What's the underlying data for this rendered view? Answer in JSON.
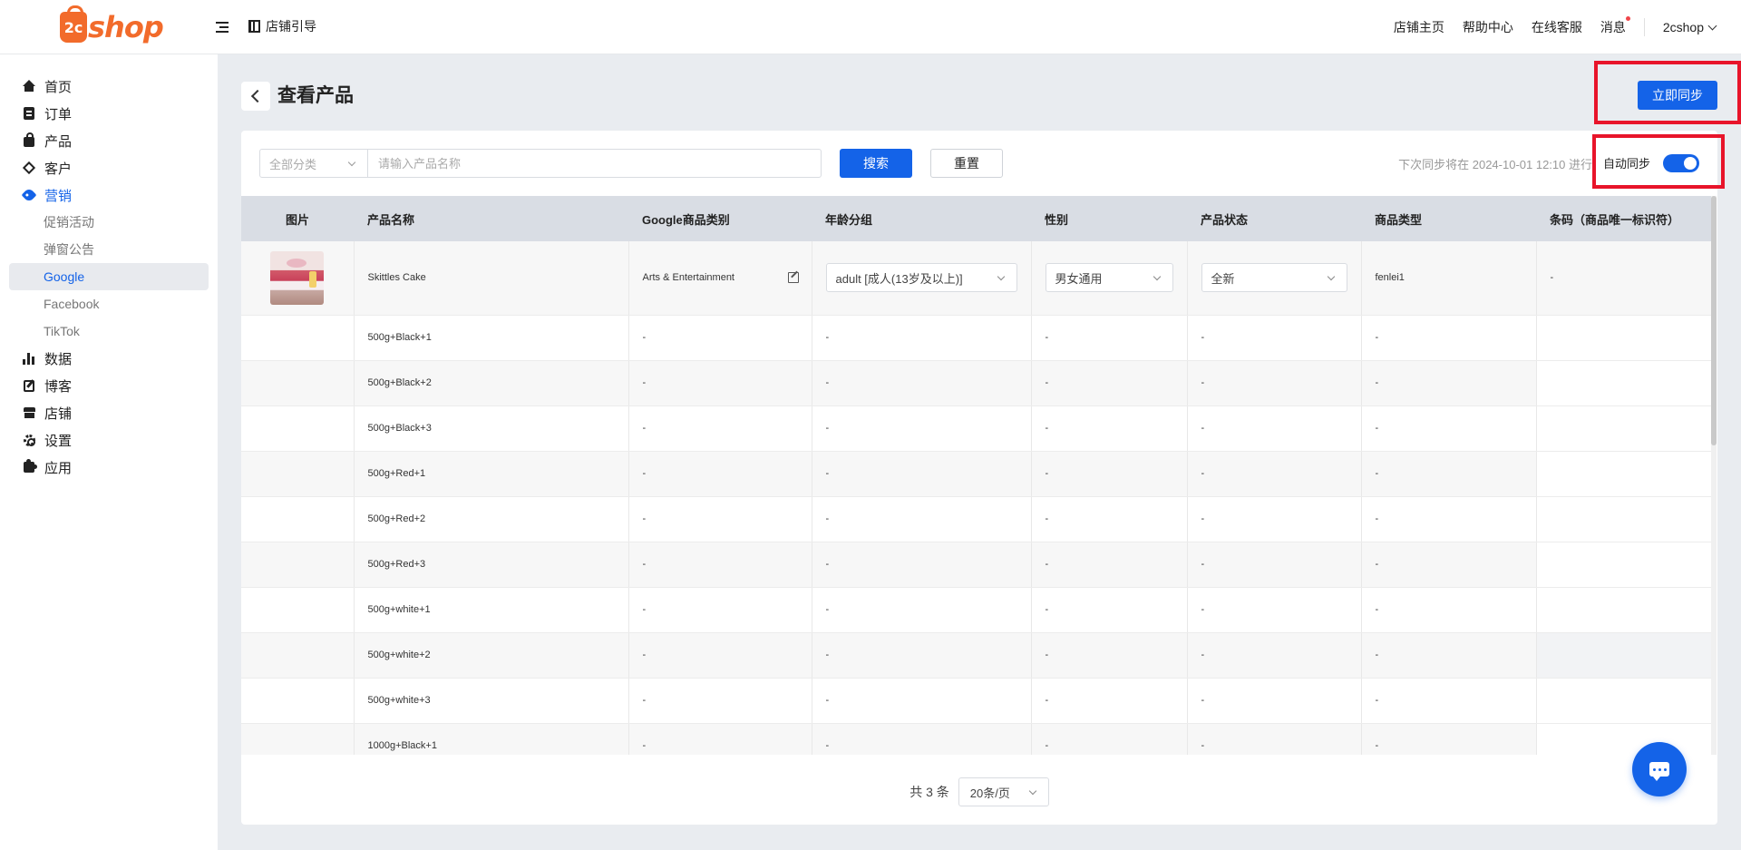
{
  "brand": {
    "logo_mark": "2c",
    "logo_text": "shop",
    "color": "#f26b2b"
  },
  "header": {
    "guide_label": "店铺引导",
    "links": [
      "店铺主页",
      "帮助中心",
      "在线客服",
      "消息"
    ],
    "user_name": "2cshop"
  },
  "sidebar": {
    "items": [
      {
        "label": "首页",
        "icon": "home-icon"
      },
      {
        "label": "订单",
        "icon": "clipboard-icon"
      },
      {
        "label": "产品",
        "icon": "bag-icon"
      },
      {
        "label": "客户",
        "icon": "diamond-icon"
      },
      {
        "label": "营销",
        "icon": "tag-icon",
        "active": true
      },
      {
        "label": "数据",
        "icon": "bar-chart-icon"
      },
      {
        "label": "博客",
        "icon": "edit-icon"
      },
      {
        "label": "店铺",
        "icon": "store-icon"
      },
      {
        "label": "设置",
        "icon": "gear-icon"
      },
      {
        "label": "应用",
        "icon": "puzzle-icon"
      }
    ],
    "marketing_sub": [
      "促销活动",
      "弹窗公告",
      "Google",
      "Facebook",
      "TikTok"
    ],
    "selected_sub": "Google"
  },
  "page": {
    "title": "查看产品",
    "sync_now_label": "立即同步"
  },
  "filters": {
    "category_placeholder": "全部分类",
    "search_placeholder": "请输入产品名称",
    "search_label": "搜索",
    "reset_label": "重置",
    "next_sync_text": "下次同步将在 2024-10-01 12:10 进行",
    "auto_sync_label": "自动同步",
    "auto_sync_on": true
  },
  "table": {
    "columns": [
      "图片",
      "产品名称",
      "Google商品类别",
      "年龄分组",
      "性别",
      "产品状态",
      "商品类型",
      "条码（商品唯一标识符）"
    ],
    "main_row": {
      "name": "Skittles Cake",
      "google_category": "Arts & Entertainment",
      "age_group": "adult [成人(13岁及以上)]",
      "gender": "男女通用",
      "condition": "全新",
      "product_type": "fenlei1",
      "barcode": "-"
    },
    "variants": [
      "500g+Black+1",
      "500g+Black+2",
      "500g+Black+3",
      "500g+Red+1",
      "500g+Red+2",
      "500g+Red+3",
      "500g+white+1",
      "500g+white+2",
      "500g+white+3",
      "1000g+Black+1"
    ],
    "placeholder": "-"
  },
  "pagination": {
    "total_text": "共 3 条",
    "page_size": "20条/页"
  },
  "colors": {
    "primary": "#1463e8",
    "highlight_border": "#e8142a"
  }
}
